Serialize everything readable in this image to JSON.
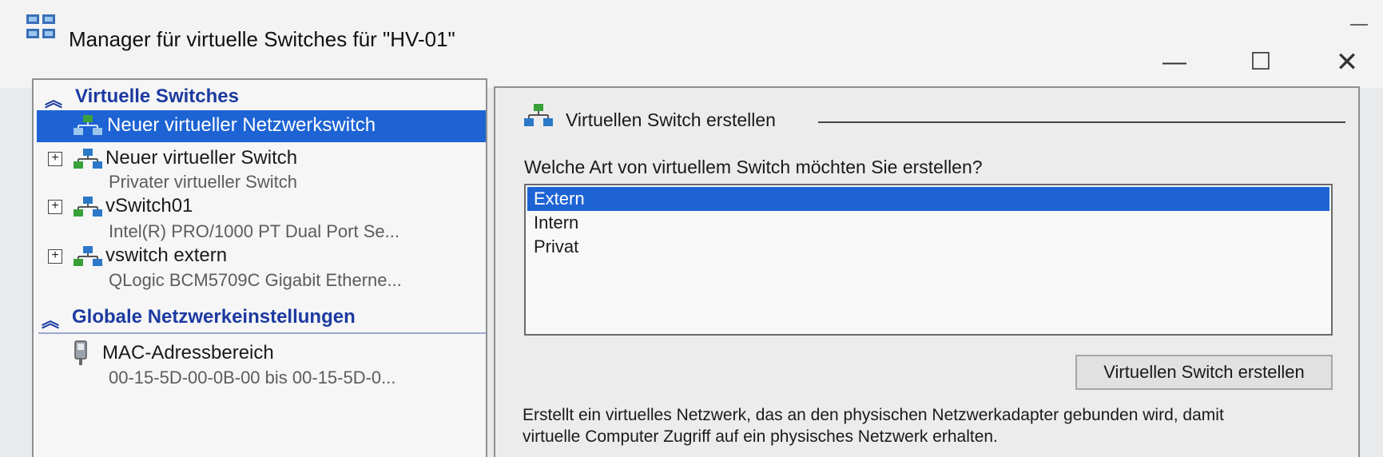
{
  "window": {
    "title": "Manager für virtuelle Switches für \"HV-01\"",
    "controls": {
      "minimize": "—",
      "maximize": "☐",
      "close": "✕"
    }
  },
  "left_pane": {
    "section1": {
      "label": "Virtuelle Switches"
    },
    "items": [
      {
        "label": "Neuer virtueller Netzwerkswitch",
        "selected": true
      },
      {
        "label": "Neuer virtueller Switch",
        "sub": "Privater virtueller Switch"
      },
      {
        "label": "vSwitch01",
        "sub": "Intel(R) PRO/1000 PT Dual Port Se..."
      },
      {
        "label": "vswitch extern",
        "sub": "QLogic BCM5709C Gigabit Etherne..."
      }
    ],
    "section2": {
      "label": "Globale Netzwerkeinstellungen"
    },
    "mac_item": {
      "label": "MAC-Adressbereich",
      "sub": "00-15-5D-00-0B-00 bis 00-15-5D-0..."
    }
  },
  "right_pane": {
    "group_title": "Virtuellen Switch erstellen",
    "question": "Welche Art von virtuellem Switch möchten Sie erstellen?",
    "options": [
      "Extern",
      "Intern",
      "Privat"
    ],
    "selected_option": "Extern",
    "create_button": "Virtuellen Switch erstellen",
    "description": "Erstellt ein virtuelles Netzwerk, das an den physischen Netzwerkadapter gebunden wird, damit virtuelle Computer Zugriff auf ein physisches Netzwerk erhalten."
  },
  "colors": {
    "selection": "#1d63d4",
    "section_header": "#1c3aa1",
    "icon_blue": "#2b78c9",
    "icon_green": "#3aa13a"
  },
  "icons": [
    "switch-manager-icon",
    "network-switch-icon",
    "new-switch-icon",
    "mac-address-icon",
    "collapse-chevron-icon",
    "expand-plus-icon"
  ]
}
